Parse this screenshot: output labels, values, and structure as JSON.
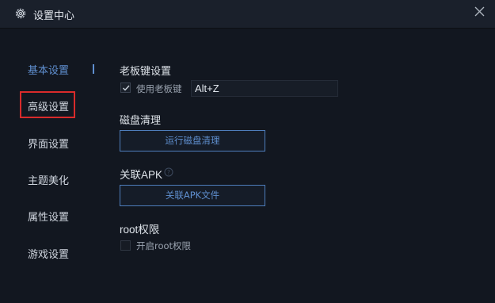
{
  "window": {
    "title": "设置中心"
  },
  "icons": {
    "settings": "gear-icon",
    "close": "close-icon",
    "check": "check-icon",
    "help": "question-circle-icon"
  },
  "colors": {
    "accent": "#5f8fcf",
    "background": "#121720",
    "highlight_border": "#d92b2b"
  },
  "sidebar": {
    "items": [
      {
        "label": "基本设置",
        "active": true
      },
      {
        "label": "高级设置",
        "active": false
      },
      {
        "label": "界面设置",
        "active": false
      },
      {
        "label": "主题美化",
        "active": false
      },
      {
        "label": "属性设置",
        "active": false
      },
      {
        "label": "游戏设置",
        "active": false
      }
    ]
  },
  "boss_key": {
    "title": "老板键设置",
    "checkbox_label": "使用老板键",
    "checked": true,
    "hotkey": "Alt+Z"
  },
  "disk": {
    "title": "磁盘清理",
    "button": "运行磁盘清理"
  },
  "apk": {
    "title": "关联APK",
    "button": "关联APK文件"
  },
  "root": {
    "title": "root权限",
    "checkbox_label": "开启root权限",
    "checked": false
  }
}
